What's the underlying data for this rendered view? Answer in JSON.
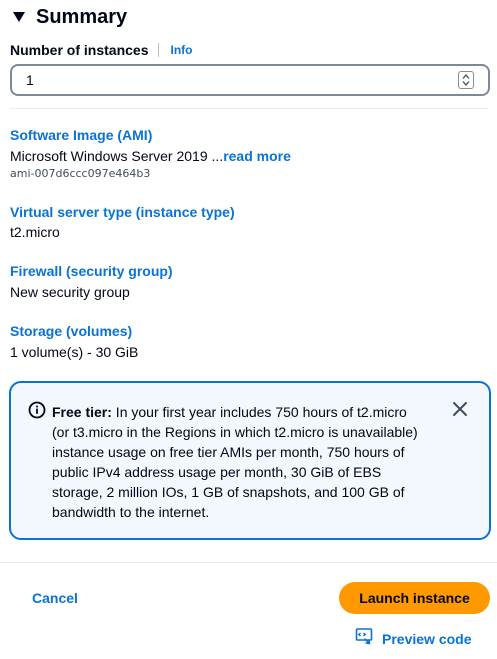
{
  "summary": {
    "title": "Summary",
    "instances": {
      "label": "Number of instances",
      "info_label": "Info",
      "value": "1"
    },
    "ami": {
      "label": "Software Image (AMI)",
      "value": "Microsoft Windows Server 2019 ...",
      "read_more": "read more",
      "id": "ami-007d6ccc097e464b3"
    },
    "instance_type": {
      "label": "Virtual server type (instance type)",
      "value": "t2.micro"
    },
    "firewall": {
      "label": "Firewall (security group)",
      "value": "New security group"
    },
    "storage": {
      "label": "Storage (volumes)",
      "value": "1 volume(s) - 30 GiB"
    },
    "free_tier": {
      "title": "Free tier:",
      "lines": [
        " In your first year includes 750 hours of t2.micro",
        "(or t3.micro in the Regions in which t2.micro is unavailable)",
        "instance usage on free tier AMIs per month, 750 hours of",
        "public IPv4 address usage per month, 30 GiB of EBS",
        "storage, 2 million IOs, 1 GB of snapshots, and 100 GB of",
        "bandwidth to the internet."
      ]
    }
  },
  "actions": {
    "cancel_label": "Cancel",
    "launch_label": "Launch instance",
    "preview_label": "Preview code"
  },
  "icons": {
    "caret": "caret-down-icon",
    "info": "info-circle-icon",
    "close": "close-icon",
    "preview": "code-preview-icon"
  },
  "colors": {
    "link": "#0972d3",
    "primary_button": "#ff9900",
    "alert_border": "#0972d3",
    "alert_background": "#f2f8fd"
  }
}
